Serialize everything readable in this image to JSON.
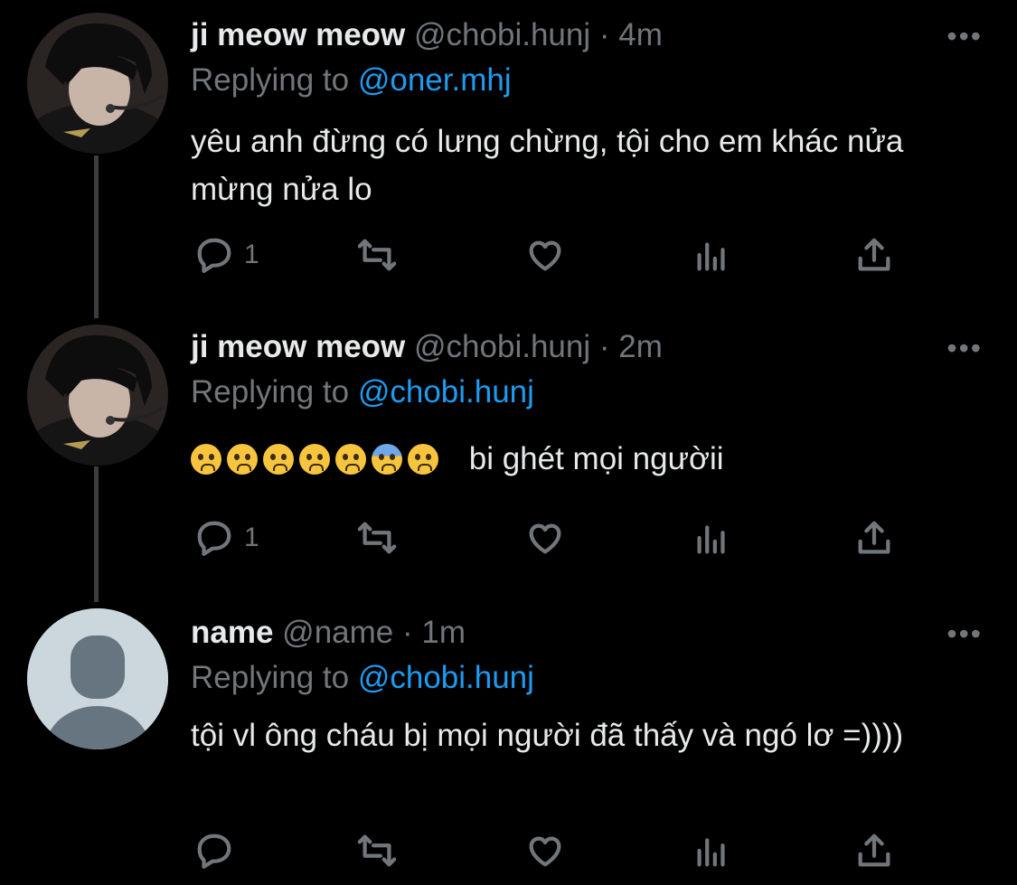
{
  "tweets": [
    {
      "name": "ji meow meow",
      "handle": "@chobi.hunj",
      "dot": "·",
      "time": "4m",
      "more": "•••",
      "replying_label": "Replying to ",
      "replying_handle": "@oner.mhj",
      "text": "yêu anh đừng có lưng chừng, tội cho em khác nửa mừng nửa lo",
      "reply_count": "1",
      "avatar": "photo-avatar"
    },
    {
      "name": "ji meow meow",
      "handle": "@chobi.hunj",
      "dot": "·",
      "time": "2m",
      "more": "•••",
      "replying_label": "Replying to ",
      "replying_handle": "@chobi.hunj",
      "emojis": [
        "pleading-face",
        "pleading-face",
        "crying-face",
        "sad-tear-face",
        "disappointed-relieved-face",
        "anxious-sweat-face",
        "loudly-crying-face"
      ],
      "text": "bi ghét mọi ngườii",
      "reply_count": "1",
      "avatar": "photo-avatar"
    },
    {
      "name": "name",
      "handle": "@name",
      "dot": "·",
      "time": "1m",
      "more": "•••",
      "replying_label": "Replying to ",
      "replying_handle": "@chobi.hunj",
      "text": "tội vl ông cháu bị mọi người đã thấy và ngó lơ =))))",
      "reply_count": "",
      "avatar": "default-avatar"
    }
  ],
  "colors": {
    "background": "#000000",
    "text": "#e7e9ea",
    "secondary": "#71767b",
    "accent": "#1d9bf0",
    "thread_line": "#3a3d41"
  }
}
